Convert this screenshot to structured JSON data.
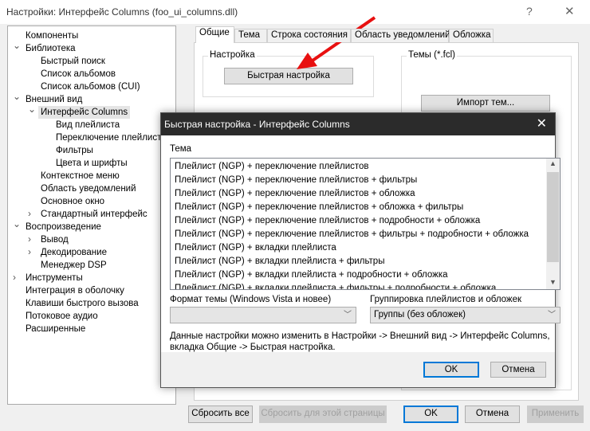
{
  "window": {
    "title": "Настройки: Интерфейс Columns (foo_ui_columns.dll)",
    "help": "?",
    "close": "✕"
  },
  "tree": [
    {
      "label": "Компоненты",
      "level": 0,
      "exp": ""
    },
    {
      "label": "Библиотека",
      "level": 0,
      "exp": "v"
    },
    {
      "label": "Быстрый поиск",
      "level": 1,
      "exp": ""
    },
    {
      "label": "Список альбомов",
      "level": 1,
      "exp": ""
    },
    {
      "label": "Список альбомов (CUI)",
      "level": 1,
      "exp": ""
    },
    {
      "label": "Внешний вид",
      "level": 0,
      "exp": "v"
    },
    {
      "label": "Интерфейс Columns",
      "level": 1,
      "exp": "v",
      "selected": true
    },
    {
      "label": "Вид плейлиста",
      "level": 2,
      "exp": ""
    },
    {
      "label": "Переключение плейлистов",
      "level": 2,
      "exp": ""
    },
    {
      "label": "Фильтры",
      "level": 2,
      "exp": ""
    },
    {
      "label": "Цвета и шрифты",
      "level": 2,
      "exp": ""
    },
    {
      "label": "Контекстное меню",
      "level": 1,
      "exp": ""
    },
    {
      "label": "Область уведомлений",
      "level": 1,
      "exp": ""
    },
    {
      "label": "Основное окно",
      "level": 1,
      "exp": ""
    },
    {
      "label": "Стандартный интерфейс",
      "level": 1,
      "exp": ">"
    },
    {
      "label": "Воспроизведение",
      "level": 0,
      "exp": "v"
    },
    {
      "label": "Вывод",
      "level": 1,
      "exp": ">"
    },
    {
      "label": "Декодирование",
      "level": 1,
      "exp": ">"
    },
    {
      "label": "Менеджер DSP",
      "level": 1,
      "exp": ""
    },
    {
      "label": "Инструменты",
      "level": 0,
      "exp": ">"
    },
    {
      "label": "Интеграция в оболочку",
      "level": 0,
      "exp": ""
    },
    {
      "label": "Клавиши быстрого вызова",
      "level": 0,
      "exp": ""
    },
    {
      "label": "Потоковое аудио",
      "level": 0,
      "exp": ""
    },
    {
      "label": "Расширенные",
      "level": 0,
      "exp": ""
    }
  ],
  "tabs": [
    "Общие",
    "Тема",
    "Строка состояния",
    "Область уведомлений",
    "Обложка"
  ],
  "panel": {
    "settings_group": "Настройка",
    "quick_setup": "Быстрая настройка",
    "themes_group": "Темы (*.fcl)",
    "import": "Импорт тем..."
  },
  "bottom": {
    "reset_all": "Сбросить все",
    "reset_page": "Сбросить для этой страницы",
    "ok": "OK",
    "cancel": "Отмена",
    "apply": "Применить"
  },
  "dialog": {
    "title": "Быстрая настройка - Интерфейс Columns",
    "close": "✕",
    "theme_label": "Тема",
    "themes": [
      "Плейлист (NGP) + переключение плейлистов",
      "Плейлист (NGP) + переключение плейлистов + фильтры",
      "Плейлист (NGP) + переключение плейлистов + обложка",
      "Плейлист (NGP) + переключение плейлистов + обложка + фильтры",
      "Плейлист (NGP) + переключение плейлистов + подробности + обложка",
      "Плейлист (NGP) + переключение плейлистов + фильтры + подробности + обложка",
      "Плейлист (NGP) + вкладки плейлиста",
      "Плейлист (NGP) + вкладки плейлиста + фильтры",
      "Плейлист (NGP) + вкладки плейлиста + подробности + обложка",
      "Плейлист (NGP) + вкладки плейлиста + фильтры + подробности + обложка"
    ],
    "format_label": "Формат темы (Windows Vista и новее)",
    "format_value": "",
    "grouping_label": "Группировка плейлистов и обложек",
    "grouping_value": "Группы (без обложек)",
    "note_1": "Данные настройки можно изменить в Настройки -> Внешний вид -> Интерфейс Columns,",
    "note_2": "вкладка Общие -> Быстрая настройка.",
    "ok": "OK",
    "cancel": "Отмена"
  },
  "colors": {
    "accent": "#0078d7",
    "arrow": "#e81010",
    "dialog_title": "#2b2b2b"
  }
}
